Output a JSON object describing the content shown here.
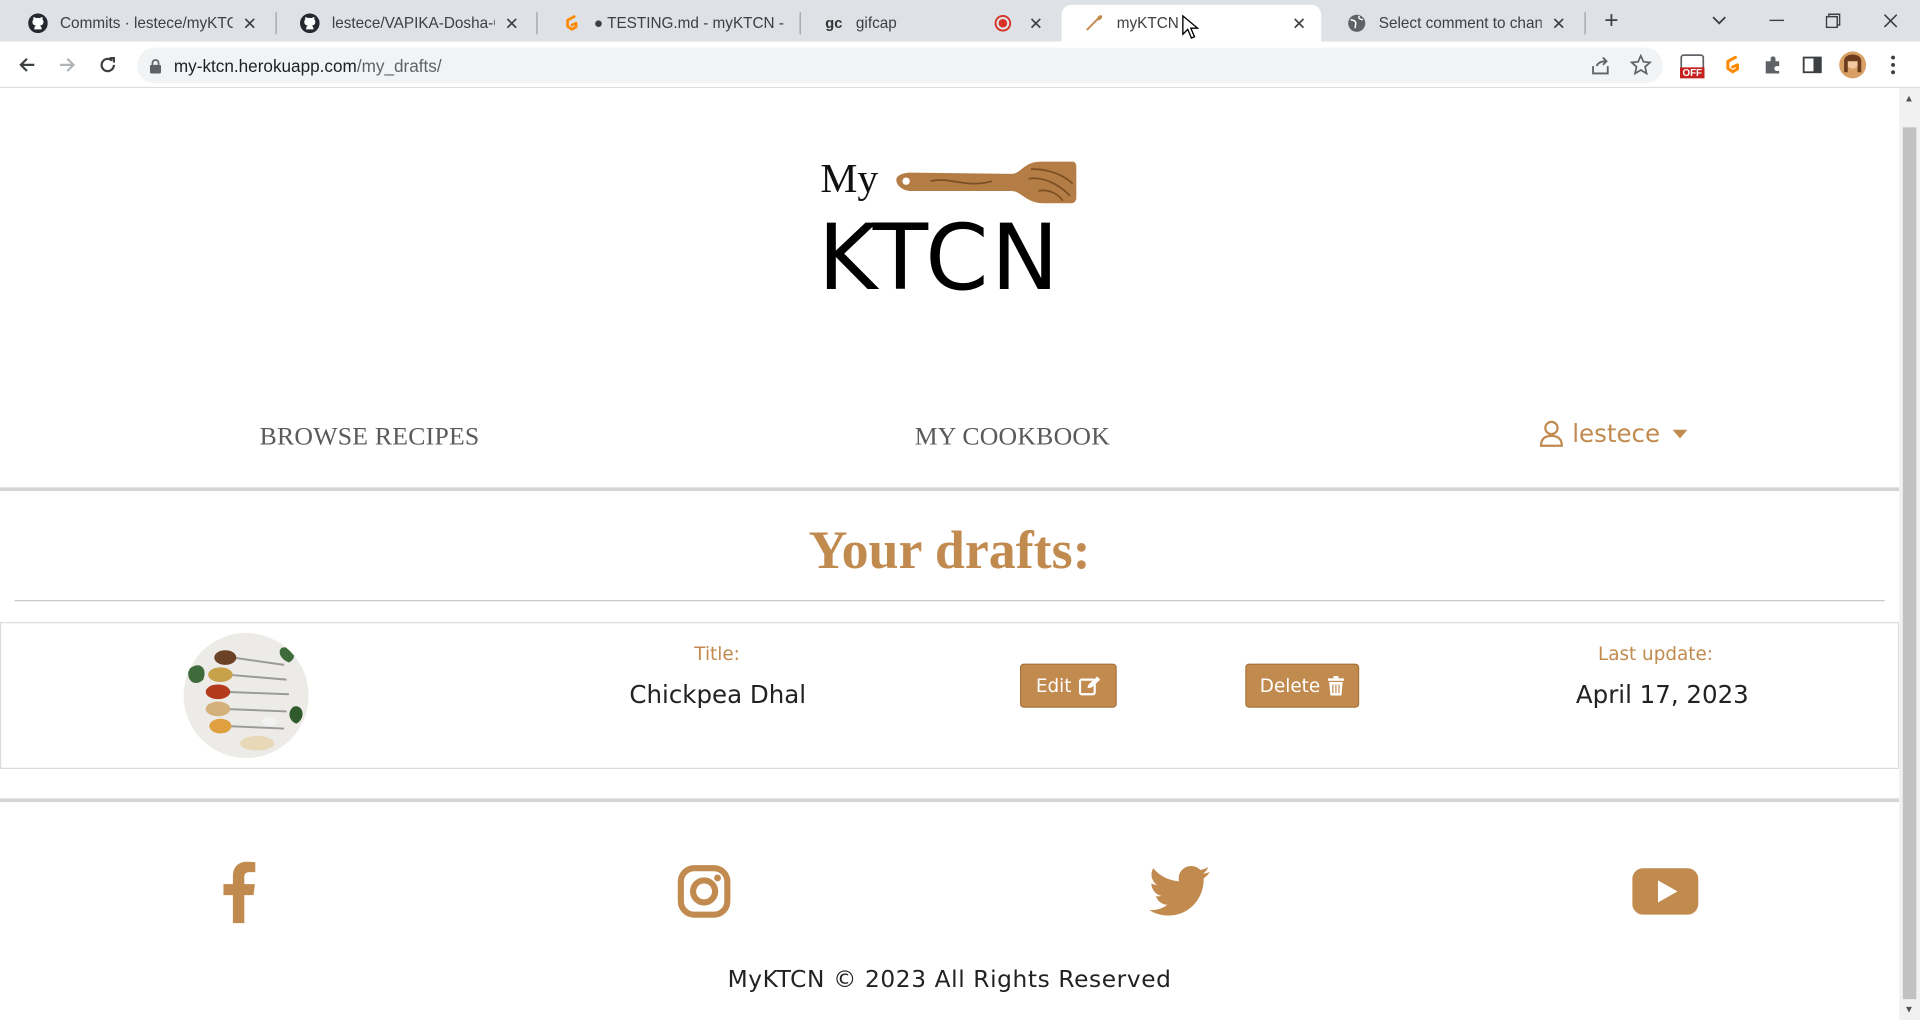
{
  "browser": {
    "tabs": [
      {
        "title": "Commits · lestece/myKTCN",
        "icon": "github-icon"
      },
      {
        "title": "lestece/VAPIKA-Dosha-Quiz",
        "icon": "github-icon"
      },
      {
        "title": "● TESTING.md - myKTCN - Gitpod",
        "icon": "gitpod-icon"
      },
      {
        "title": "gifcap",
        "icon": "gifcap-icon"
      },
      {
        "title": "myKTCN",
        "icon": "spoon-favicon-icon"
      },
      {
        "title": "Select comment to change",
        "icon": "globe-icon"
      }
    ],
    "url_host": "my-ktcn.herokuapp.com",
    "url_path": "/my_drafts/",
    "extension_badge": "OFF"
  },
  "site": {
    "logo_small": "My",
    "logo_big": "KTCN",
    "nav": {
      "browse": "BROWSE RECIPES",
      "cookbook": "MY COOKBOOK",
      "user": "lestece"
    },
    "heading": "Your drafts:",
    "drafts": [
      {
        "title_label": "Title:",
        "title": "Chickpea Dhal",
        "edit_label": "Edit",
        "delete_label": "Delete",
        "update_label": "Last update:",
        "updated": "April 17, 2023"
      }
    ],
    "footer": {
      "copyright": "MyKTCN © 2023 All Rights Reserved",
      "social": [
        "facebook-icon",
        "instagram-icon",
        "twitter-icon",
        "youtube-icon"
      ]
    },
    "accent_color": "#c18a4f"
  }
}
